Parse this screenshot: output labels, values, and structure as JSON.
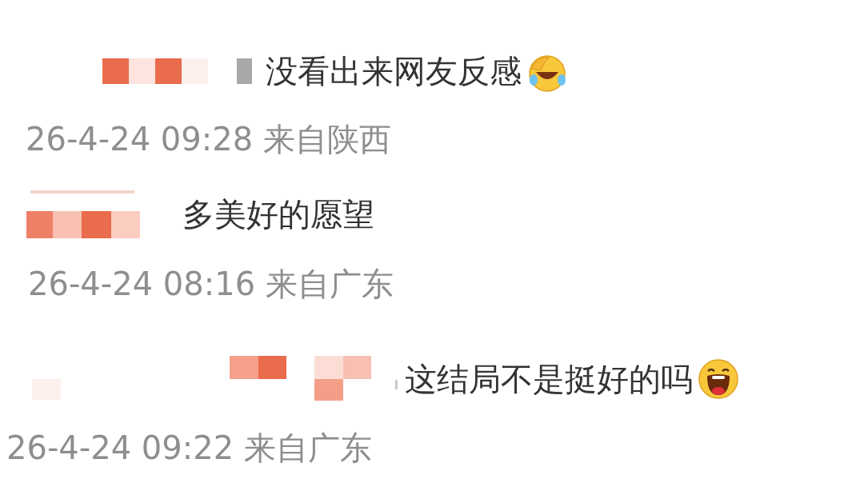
{
  "comments": [
    {
      "text": "没看出来网友反感",
      "kind": "tears",
      "meta": "26-4-24 09:28 来自陕西"
    },
    {
      "text": "多美好的愿望",
      "kind": "plain",
      "meta": "26-4-24 08:16 来自广东"
    },
    {
      "text": "这结局不是挺好的吗",
      "kind": "grin",
      "meta": "26-4-24 09:22 来自广东"
    }
  ]
}
